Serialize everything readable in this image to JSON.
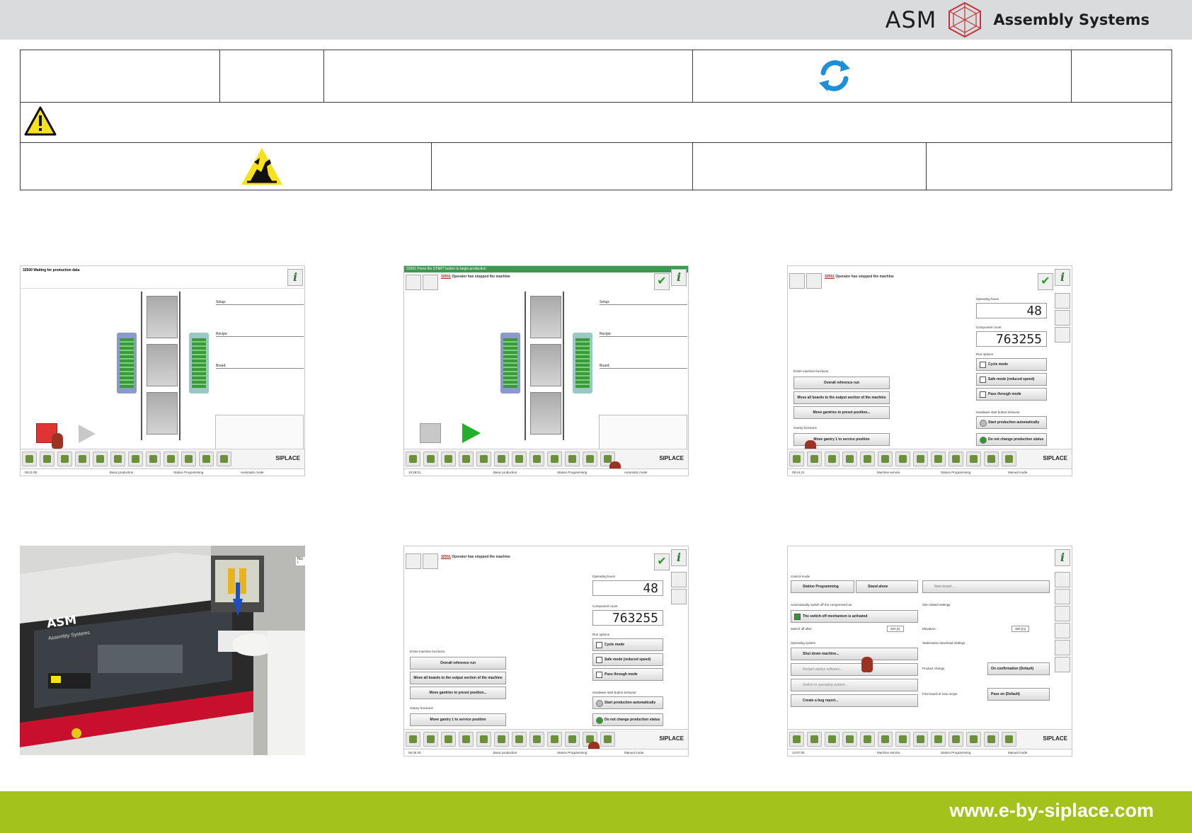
{
  "header": {
    "brand_name": "ASM",
    "brand_subtitle": "Assembly Systems"
  },
  "footer": {
    "url": "www.e-by-siplace.com"
  },
  "icons": {
    "refresh": "refresh-icon",
    "warning": "warning-triangle-icon",
    "esd": "esd-warning-icon"
  },
  "screens": {
    "s1": {
      "status": "32500 Waiting for production data",
      "setup_label": "Setup:",
      "recipe_label": "Recipe:",
      "board_label": "Board:",
      "siplace": "SIPLACE",
      "time": "09:11:00",
      "mode1": "Basic production",
      "mode2": "Station Programming",
      "mode3": "Automatic mode"
    },
    "s2": {
      "status": "32901 Press the START button to begin production",
      "message_num": "32551",
      "message_text": "Operator has stopped the machine",
      "setup_label": "Setup:",
      "recipe_label": "Recipe:",
      "board_label": "Board:",
      "siplace": "SIPLACE",
      "time": "10:28:01",
      "mode1": "Basic production",
      "mode2": "Station Programming",
      "mode3": "Automatic mode"
    },
    "s3": {
      "message_num": "32551",
      "message_text": "Operator has stopped the machine",
      "operating_hours_label": "Operating hours",
      "operating_hours": "48",
      "component_count_label": "Component count",
      "component_count": "763255",
      "run_options_label": "Run options",
      "cycle_mode": "Cycle mode",
      "safe_mode": "Safe mode (reduced speed)",
      "pass_through": "Pass through mode",
      "hw_start_label": "Hardware start button behavior",
      "start_auto": "Start production automatically",
      "no_change": "Do not change production status",
      "entire_label": "Entire machine functions",
      "ref_run": "Overall reference run",
      "move_boards": "Move all boards to the output section of the machine",
      "move_gantries": "Move gantries to preset position...",
      "gantry_label": "Gantry functions",
      "gantry1": "Move gantry 1 to service position",
      "siplace": "SIPLACE",
      "time": "09:44:21",
      "mode1": "Machine service",
      "mode2": "Station Programming",
      "mode3": "Manual mode"
    },
    "s4": {
      "brand": "ASM",
      "brand_sub": "Assembly Systems",
      "side_text": "No !"
    },
    "s5": {
      "message_num": "32551",
      "message_text": "Operator has stopped the machine",
      "operating_hours_label": "Operating hours",
      "operating_hours": "48",
      "component_count_label": "Component count",
      "component_count": "763255",
      "run_options_label": "Run options",
      "cycle_mode": "Cycle mode",
      "safe_mode": "Safe mode (reduced speed)",
      "pass_through": "Pass through mode",
      "hw_start_label": "Hardware start button behavior",
      "start_auto": "Start production automatically",
      "no_change": "Do not change production status",
      "entire_label": "Entire machine functions",
      "ref_run": "Overall reference run",
      "move_boards": "Move all boards to the output section of the machine",
      "move_gantries": "Move gantries to preset position...",
      "gantry_label": "Gantry functions",
      "gantry1": "Move gantry 1 to service position",
      "siplace": "SIPLACE",
      "time": "06:35:40",
      "mode1": "Basic production",
      "mode2": "Station Programming",
      "mode3": "Manual mode"
    },
    "s6": {
      "control_mode_label": "Control mode",
      "station_programming": "Station Programming",
      "stand_alone": "Stand alone",
      "new_board": "New board ...",
      "auto_switch_label": "Automatically switch off the compressed air",
      "switch_off_active": "The switch-off mechanism is activated",
      "switch_off_after": "Switch off after:",
      "switch_off_value": "300 [s]",
      "site_label": "Site related settings",
      "elevation": "Elevation:",
      "elevation_value": "350 [m]",
      "os_label": "Operating system",
      "shut_down": "Shut down machine...",
      "restart": "Restart station software...",
      "switch_os": "Switch to operating system...",
      "bug_report": "Create a bug report...",
      "download_label": "Stationwise download settings",
      "product_change": "Product change",
      "product_change_value": "On confirmation (Default)",
      "first_board": "First board of new recipe",
      "first_board_value": "Pass on (Default)",
      "siplace": "SIPLACE",
      "time": "13:07:05",
      "mode1": "Machine service",
      "mode2": "Station Programming",
      "mode3": "Manual mode"
    }
  }
}
